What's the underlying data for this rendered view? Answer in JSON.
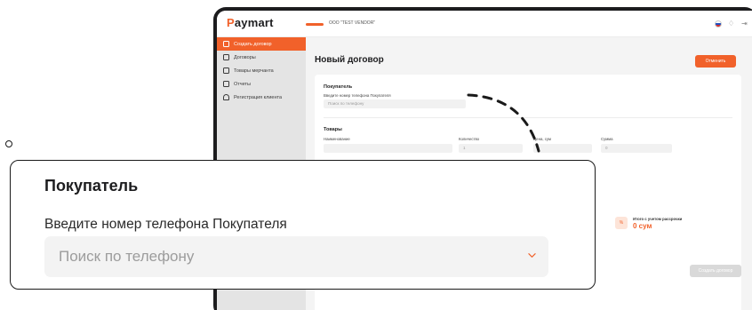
{
  "app": {
    "logo_first": "P",
    "logo_rest": "aymart",
    "vendor": "OOO \"TEST VENDOR\"",
    "accent": "#f1612a"
  },
  "sidebar": {
    "items": [
      {
        "label": "Создать договор",
        "icon": "document-plus-icon",
        "active": true
      },
      {
        "label": "Договоры",
        "icon": "documents-icon",
        "active": false
      },
      {
        "label": "Товары мерчанта",
        "icon": "box-icon",
        "active": false
      },
      {
        "label": "Отчеты",
        "icon": "chart-icon",
        "active": false
      },
      {
        "label": "Регистрация клиента",
        "icon": "user-plus-icon",
        "active": false
      }
    ]
  },
  "main": {
    "title": "Новый договор",
    "cancel_label": "Отменить",
    "buyer_section": "Покупатель",
    "phone_label": "Введите номер телефона Покупателя",
    "phone_placeholder": "Поиск по телефону",
    "goods_section": "Товары",
    "columns": [
      "Наименование",
      "Количество",
      "Цена, сум",
      "Сумма"
    ],
    "qty_value": "1",
    "sum_value": "0",
    "total_label": "Итого с учетом рассрочки",
    "total_value": "0 сум",
    "total_icon": "%",
    "create_label": "Создать договор"
  },
  "callout": {
    "title": "Покупатель",
    "phone_label": "Введите номер телефона Покупателя",
    "phone_placeholder": "Поиск по телефону"
  }
}
